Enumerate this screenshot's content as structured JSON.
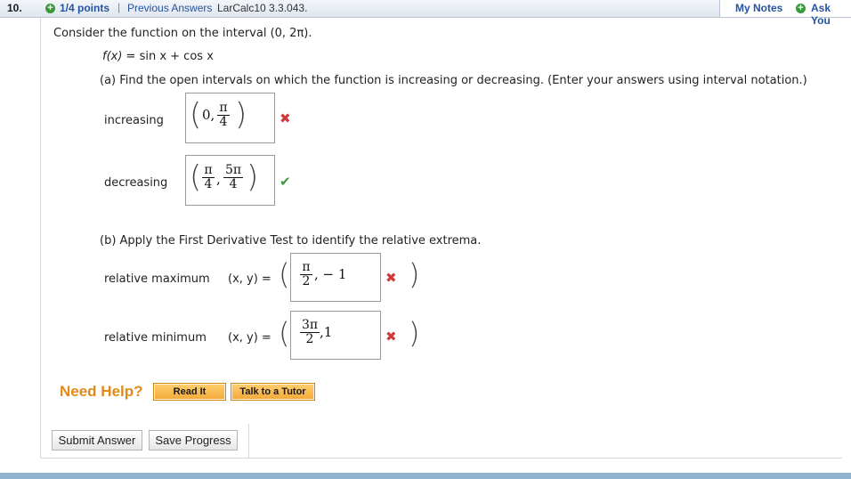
{
  "header": {
    "question_number": "10.",
    "points": "1/4 points",
    "separator": "|",
    "previous_answers": "Previous Answers",
    "assignment_code": "LarCalc10 3.3.043.",
    "my_notes": "My Notes",
    "ask_your": "Ask You"
  },
  "question": {
    "prompt": "Consider the function on the interval  (0, 2π).",
    "function_label": "f(x)",
    "function_rhs": " = sin x + cos x",
    "part_a": "(a) Find the open intervals on which the function is increasing or decreasing. (Enter your answers using interval notation.)",
    "part_b": "(b) Apply the First Derivative Test to identify the relative extrema."
  },
  "answers": {
    "increasing": {
      "label": "increasing",
      "lead": "0,",
      "num": "π",
      "den": "4",
      "status": "incorrect"
    },
    "decreasing": {
      "label": "decreasing",
      "num1": "π",
      "den1": "4",
      "comma": ",",
      "num2": "5π",
      "den2": "4",
      "status": "correct"
    },
    "rel_max": {
      "label": "relative maximum",
      "xy": "(x, y)  =",
      "num": "π",
      "den": "2",
      "tail": ", − 1",
      "status": "incorrect"
    },
    "rel_min": {
      "label": "relative minimum",
      "xy": "(x, y)  =",
      "num": "3π",
      "den": "2",
      "tail": ",1",
      "status": "incorrect"
    }
  },
  "icons": {
    "incorrect": "✖",
    "correct": "✔"
  },
  "help": {
    "title": "Need Help?",
    "read_it": "Read It",
    "talk_to_tutor": "Talk to a Tutor"
  },
  "actions": {
    "submit": "Submit Answer",
    "save": "Save Progress"
  },
  "colors": {
    "link_blue": "#2553a0",
    "incorrect_red": "#d03a3a",
    "correct_green": "#3b9a3b",
    "help_orange": "#e28a17"
  }
}
